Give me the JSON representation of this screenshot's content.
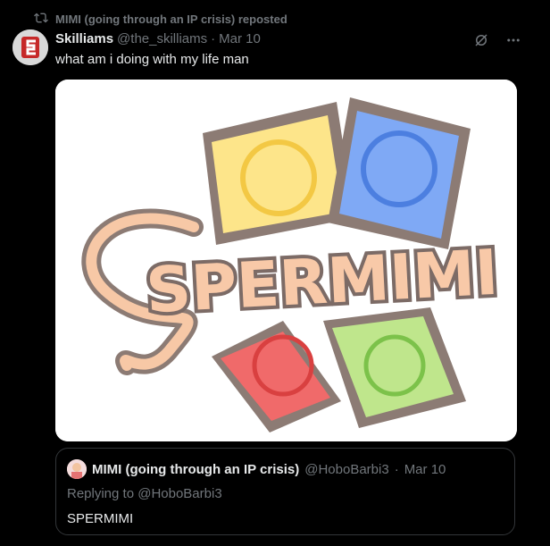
{
  "repost_header": {
    "text": "MIMI (going through an IP crisis) reposted",
    "icon": "repost-icon"
  },
  "tweet": {
    "author_name": "Skilliams",
    "author_handle": "@the_skilliams",
    "separator": "·",
    "date": "Mar 10",
    "text": "what am i doing with my life man",
    "media_text": "SPERMIMI",
    "actions": {
      "grok_icon": "grok-icon",
      "more_icon": "more-icon"
    }
  },
  "quote": {
    "author_name": "MIMI (going through an IP crisis)",
    "author_handle": "@HoboBarbi3",
    "separator": "·",
    "date": "Mar 10",
    "replying_prefix": "Replying to ",
    "replying_handle": "@HoboBarbi3",
    "text": "SPERMIMI"
  }
}
